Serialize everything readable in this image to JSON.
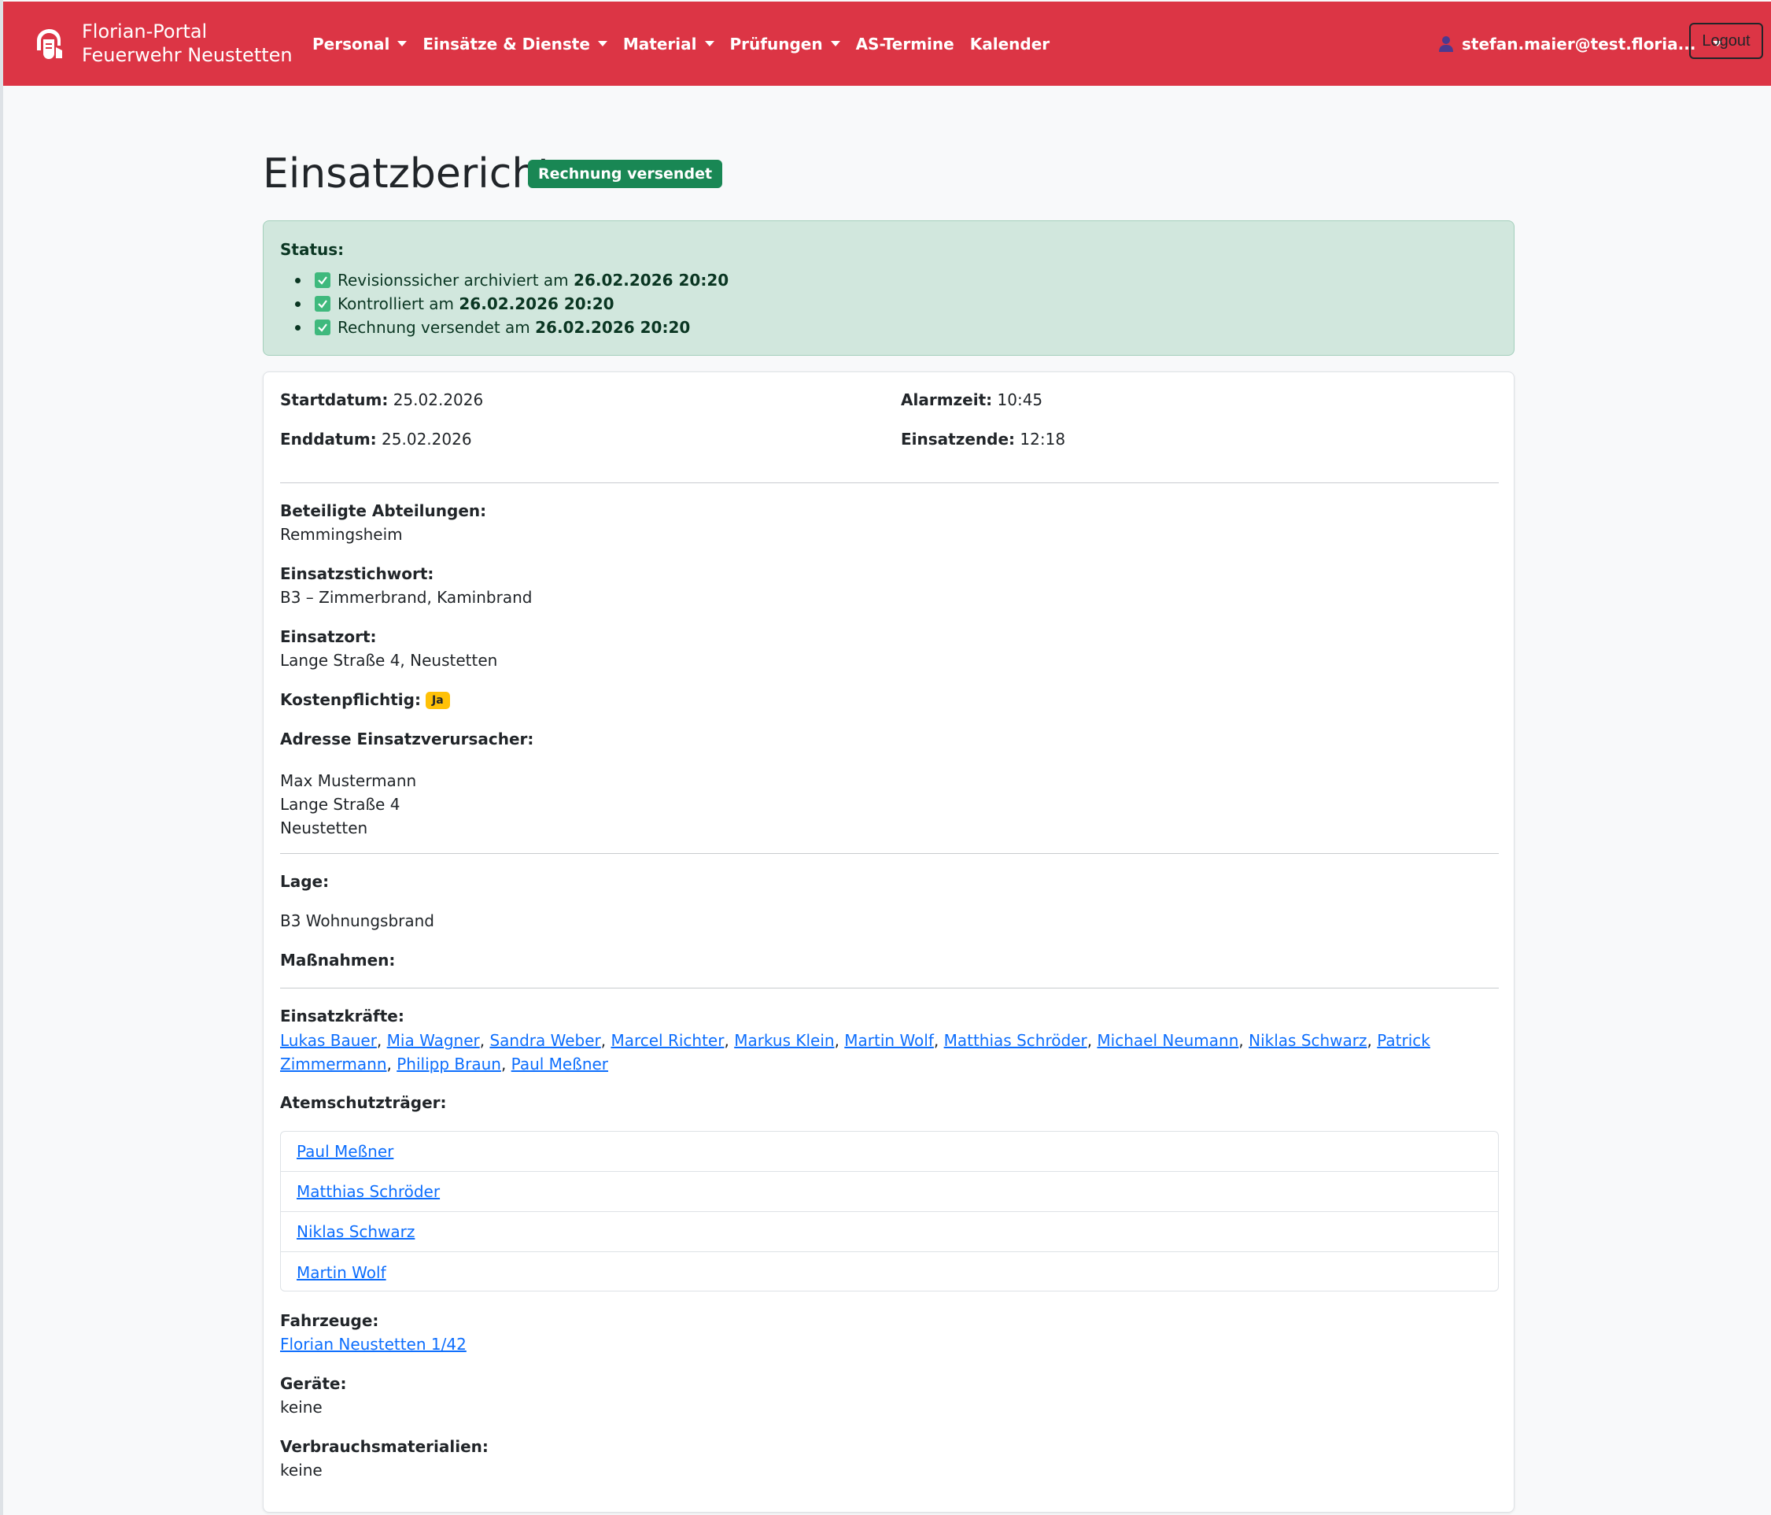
{
  "brand": {
    "line1": "Florian-Portal",
    "line2": "Feuerwehr Neustetten",
    "logo_icon": "firefighter-helmet-icon"
  },
  "nav": {
    "items": [
      {
        "label": "Personal",
        "dropdown": true
      },
      {
        "label": "Einsätze & Dienste",
        "dropdown": true
      },
      {
        "label": "Material",
        "dropdown": true
      },
      {
        "label": "Prüfungen",
        "dropdown": true
      },
      {
        "label": "AS-Termine",
        "dropdown": false
      },
      {
        "label": "Kalender",
        "dropdown": false
      }
    ],
    "user": "stefan.maier@test.floria...",
    "logout": "Logout"
  },
  "page": {
    "title": "Einsatzbericht",
    "badge": "Rechnung versendet"
  },
  "status": {
    "label": "Status:",
    "items": [
      {
        "text": "Revisionssicher archiviert am",
        "date": "26.02.2026 20:20"
      },
      {
        "text": "Kontrolliert am",
        "date": "26.02.2026 20:20"
      },
      {
        "text": "Rechnung versendet am",
        "date": "26.02.2026 20:20"
      }
    ]
  },
  "report": {
    "start_label": "Startdatum:",
    "start": "25.02.2026",
    "alarm_label": "Alarmzeit:",
    "alarm": "10:45",
    "end_label": "Enddatum:",
    "end": "25.02.2026",
    "einsatzende_label": "Einsatzende:",
    "einsatzende": "12:18",
    "abteilungen_label": "Beteiligte Abteilungen:",
    "abteilungen": "Remmingsheim",
    "stichwort_label": "Einsatzstichwort:",
    "stichwort": "B3 – Zimmerbrand, Kaminbrand",
    "ort_label": "Einsatzort:",
    "ort": "Lange Straße 4, Neustetten",
    "kosten_label": "Kostenpflichtig:",
    "kosten": "Ja",
    "adresse_label": "Adresse Einsatzverursacher:",
    "adresse_lines": [
      "Max Mustermann",
      "Lange Straße 4",
      "Neustetten"
    ],
    "lage_label": "Lage:",
    "lage": "B3 Wohnungsbrand",
    "massnahmen_label": "Maßnahmen:",
    "kraefte_label": "Einsatzkräfte:",
    "kraefte": [
      "Lukas Bauer",
      "Mia Wagner",
      "Sandra Weber",
      "Marcel Richter",
      "Markus Klein",
      "Martin Wolf",
      "Matthias Schröder",
      "Michael Neumann",
      "Niklas Schwarz",
      "Patrick Zimmermann",
      "Philipp Braun",
      "Paul Meßner"
    ],
    "as_label": "Atemschutzträger:",
    "as_traeger": [
      "Paul Meßner",
      "Matthias Schröder",
      "Niklas Schwarz",
      "Martin Wolf"
    ],
    "fahrzeuge_label": "Fahrzeuge:",
    "fahrzeug": "Florian Neustetten 1/42",
    "geraete_label": "Geräte:",
    "geraete": "keine",
    "verbrauch_label": "Verbrauchsmaterialien:",
    "verbrauch": "keine"
  },
  "colors": {
    "navbar": "#dc3545",
    "success": "#198754",
    "status_bg": "#d1e7dd",
    "warning": "#ffc107",
    "link": "#0d6efd"
  }
}
